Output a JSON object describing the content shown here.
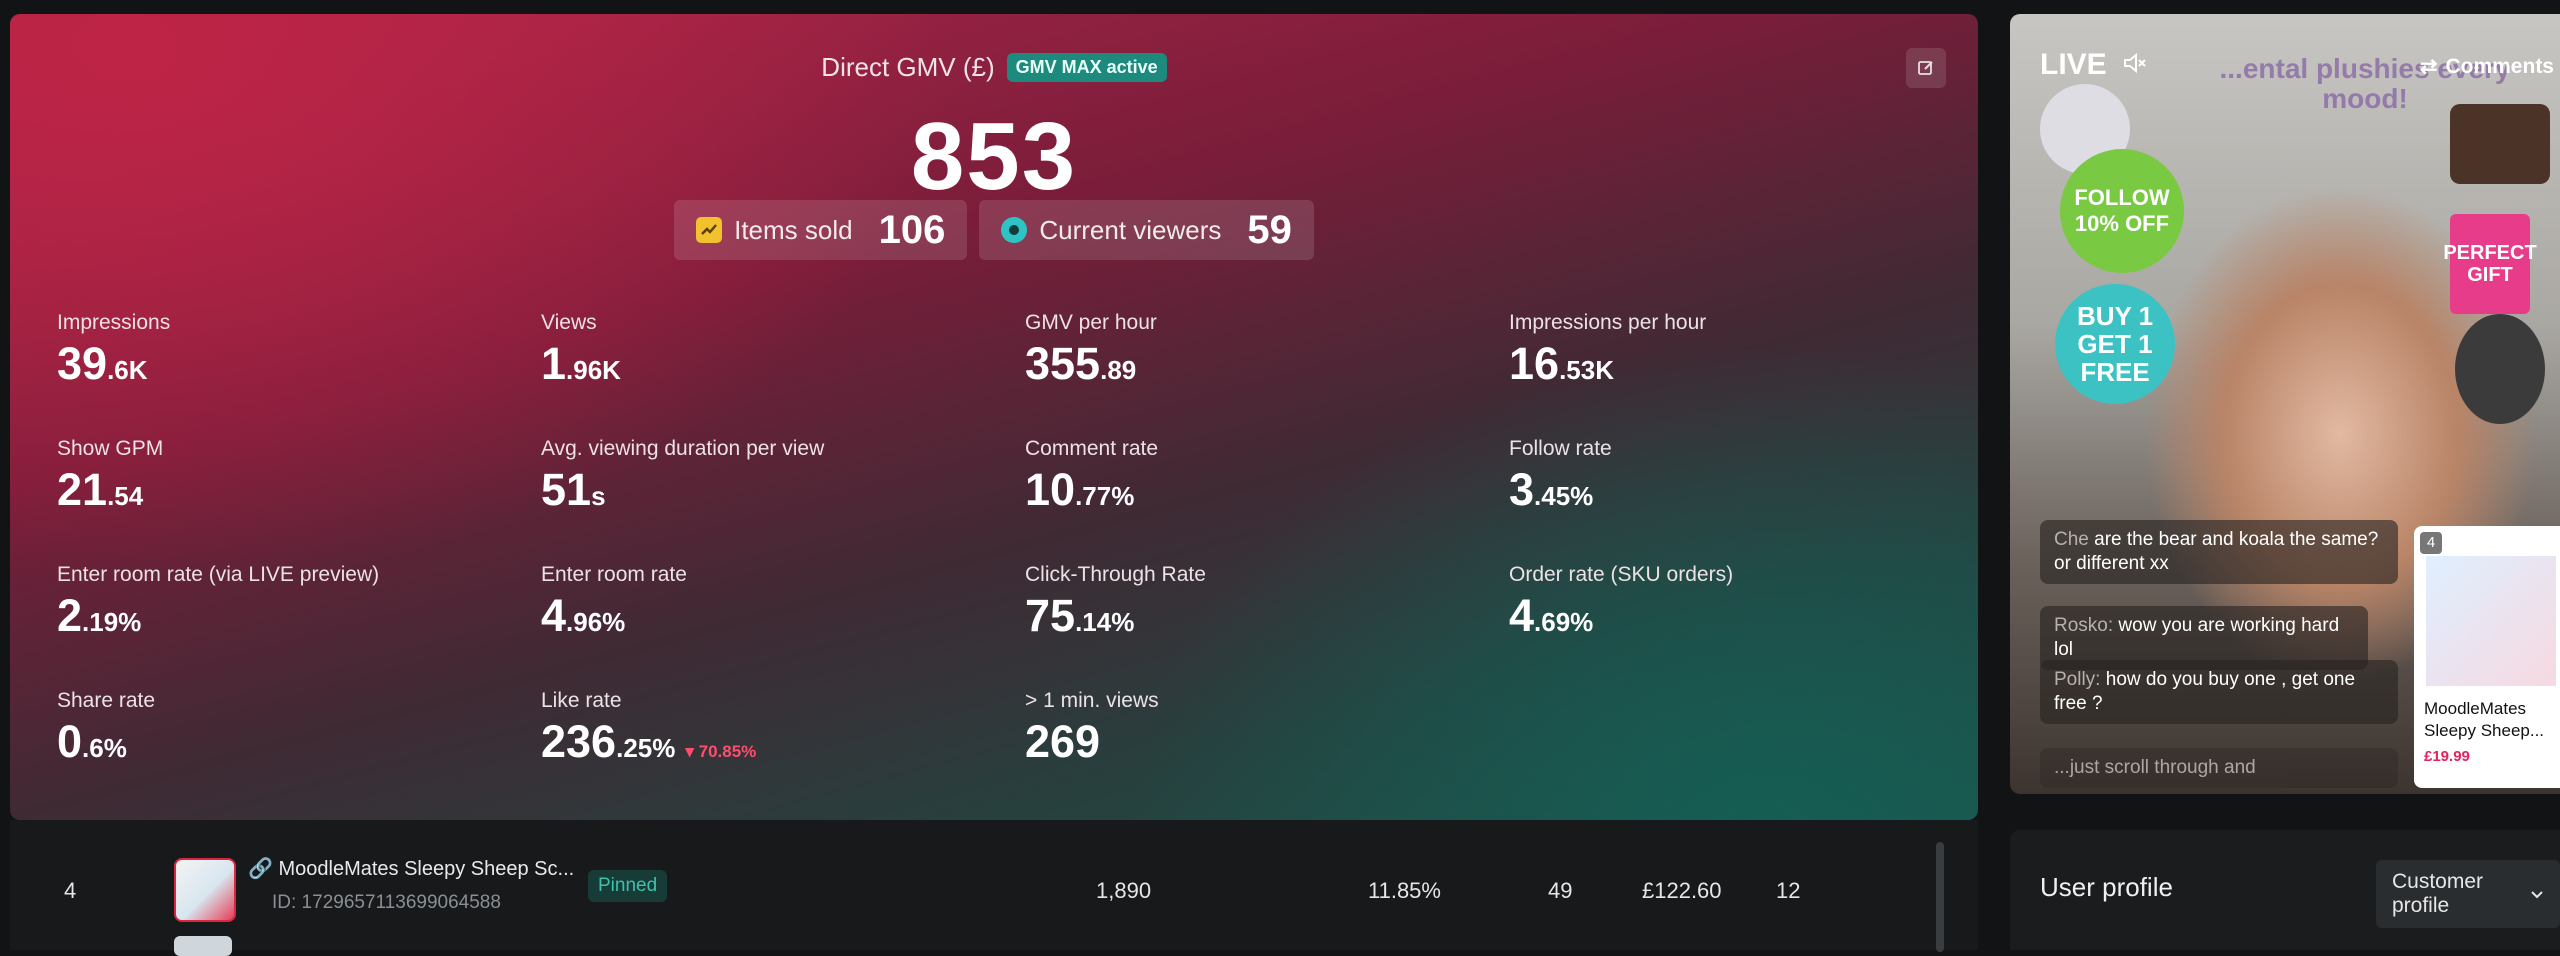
{
  "header": {
    "title": "Direct GMV (£)",
    "badge": "GMV MAX active",
    "value": "853"
  },
  "summary": {
    "items_sold_label": "Items sold",
    "items_sold_value": "106",
    "viewers_label": "Current viewers",
    "viewers_value": "59"
  },
  "metrics": [
    {
      "label": "Impressions",
      "main": "39",
      "small": ".6K"
    },
    {
      "label": "Views",
      "main": "1",
      "small": ".96K"
    },
    {
      "label": "GMV per hour",
      "main": "355",
      "small": ".89"
    },
    {
      "label": "Impressions per hour",
      "main": "16",
      "small": ".53K"
    },
    {
      "label": "Show GPM",
      "main": "21",
      "small": ".54"
    },
    {
      "label": "Avg. viewing duration per view",
      "main": "51",
      "small": "s"
    },
    {
      "label": "Comment rate",
      "main": "10",
      "small": ".77%"
    },
    {
      "label": "Follow rate",
      "main": "3",
      "small": ".45%"
    },
    {
      "label": "Enter room rate (via LIVE preview)",
      "main": "2",
      "small": ".19%"
    },
    {
      "label": "Enter room rate",
      "main": "4",
      "small": ".96%"
    },
    {
      "label": "Click-Through Rate",
      "main": "75",
      "small": ".14%"
    },
    {
      "label": "Order rate (SKU orders)",
      "main": "4",
      "small": ".69%"
    },
    {
      "label": "Share rate",
      "main": "0",
      "small": ".6%"
    },
    {
      "label": "Like rate",
      "main": "236",
      "small": ".25%",
      "delta": "▾ 70.85%"
    },
    {
      "label": "> 1 min. views",
      "main": "269",
      "small": ""
    }
  ],
  "table": {
    "row": {
      "index": "4",
      "product_name": "MoodleMates Sleepy Sheep Sc...",
      "product_id": "ID: 1729657113699064588",
      "status": "Pinned",
      "col1": "1,890",
      "col2": "11.85%",
      "col3": "£122.60",
      "col4": "49",
      "col5": "12"
    }
  },
  "live": {
    "label": "LIVE",
    "comments_label": "Comments",
    "banner": "...ental plushies every mood!",
    "promo_follow": "FOLLOW 10% OFF",
    "promo_buy": "BUY 1 GET 1 FREE",
    "gift": "PERFECT GIFT",
    "comments": [
      {
        "name": "Che",
        "text": " are the bear and koala the same? or different xx"
      },
      {
        "name": "Rosko:",
        "text": " wow you are working hard lol"
      },
      {
        "name": "Polly:",
        "text": " how do you buy one , get one free ?"
      },
      {
        "name": "",
        "text": "...just scroll through and"
      }
    ],
    "product_card": {
      "number": "4",
      "name": "MoodleMates Sleepy Sheep...",
      "price": "£19.99"
    }
  },
  "profile": {
    "title": "User profile",
    "select": "Customer profile"
  },
  "colors": {
    "badge_bg": "#1e8a7e",
    "delta_down": "#ff4d6d",
    "pinned": "#3fc0ab"
  }
}
